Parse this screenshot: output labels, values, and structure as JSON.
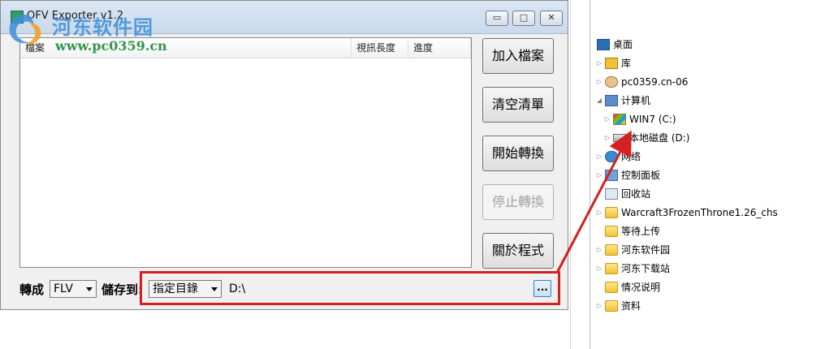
{
  "window": {
    "title": "OFV Exporter v1.2",
    "minimize_glyph": "▭",
    "maximize_glyph": "□",
    "close_glyph": "✕"
  },
  "watermark": {
    "name": "河东软件园",
    "url": "www.pc0359.cn"
  },
  "list": {
    "columns": [
      "檔案",
      "視訊長度",
      "進度"
    ]
  },
  "buttons": {
    "add_files": "加入檔案",
    "clear_list": "清空清單",
    "start_convert": "開始轉換",
    "stop_convert": "停止轉換",
    "about": "關於程式"
  },
  "bottom": {
    "convert_to_label": "轉成",
    "format_value": "FLV",
    "save_to_label": "儲存到:",
    "dest_value": "指定目錄",
    "path_value": "D:\\",
    "browse_label": "..."
  },
  "explorer": {
    "items": [
      {
        "label": "桌面",
        "icon": "desktop-icon"
      },
      {
        "label": "库",
        "icon": "library-icon"
      },
      {
        "label": "pc0359.cn-06",
        "icon": "user-folder-icon"
      },
      {
        "label": "计算机",
        "icon": "computer-icon"
      },
      {
        "label": "WIN7 (C:)",
        "icon": "system-drive-icon"
      },
      {
        "label": "本地磁盘 (D:)",
        "icon": "drive-icon"
      },
      {
        "label": "网络",
        "icon": "network-icon"
      },
      {
        "label": "控制面板",
        "icon": "control-panel-icon"
      },
      {
        "label": "回收站",
        "icon": "recycle-bin-icon"
      },
      {
        "label": "Warcraft3FrozenThrone1.26_chs",
        "icon": "folder-icon"
      },
      {
        "label": "等待上传",
        "icon": "folder-icon"
      },
      {
        "label": "河东软件园",
        "icon": "folder-icon"
      },
      {
        "label": "河东下载站",
        "icon": "folder-icon"
      },
      {
        "label": "情况说明",
        "icon": "folder-icon"
      },
      {
        "label": "资料",
        "icon": "folder-icon"
      }
    ]
  },
  "colors": {
    "highlight": "#d42020"
  }
}
